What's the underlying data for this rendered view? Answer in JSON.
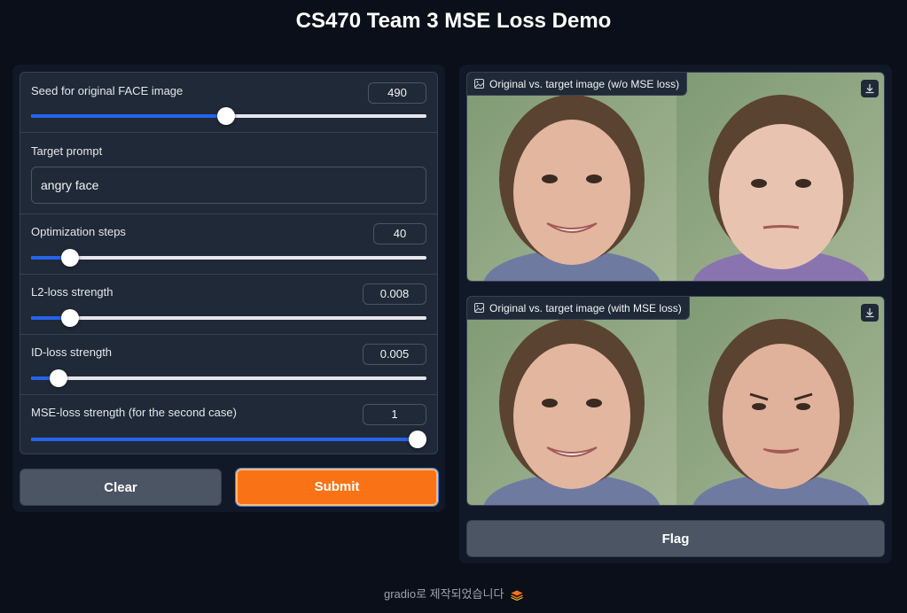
{
  "page": {
    "title": "CS470 Team 3 MSE Loss Demo"
  },
  "inputs": {
    "seed": {
      "label": "Seed for original FACE image",
      "value": "490",
      "fraction": 0.493
    },
    "prompt": {
      "label": "Target prompt",
      "value": "angry face"
    },
    "steps": {
      "label": "Optimization steps",
      "value": "40",
      "fraction": 0.098
    },
    "l2": {
      "label": "L2-loss strength",
      "value": "0.008",
      "fraction": 0.098
    },
    "id": {
      "label": "ID-loss strength",
      "value": "0.005",
      "fraction": 0.069
    },
    "mse": {
      "label": "MSE-loss strength (for the second case)",
      "value": "1",
      "fraction": 0.978
    }
  },
  "buttons": {
    "clear": "Clear",
    "submit": "Submit",
    "flag": "Flag"
  },
  "outputs": {
    "without_mse": {
      "label": "Original vs. target image (w/o MSE loss)"
    },
    "with_mse": {
      "label": "Original vs. target image (with MSE loss)"
    }
  },
  "footer": {
    "text": "gradio로 제작되었습니다"
  },
  "colors": {
    "accent": "#f97316",
    "slider": "#2563eb",
    "background": "#0b0f19",
    "panel": "#1f2937"
  },
  "icons": {
    "image_label": "image-icon",
    "download": "download-icon",
    "brand": "gradio-logo-icon"
  }
}
